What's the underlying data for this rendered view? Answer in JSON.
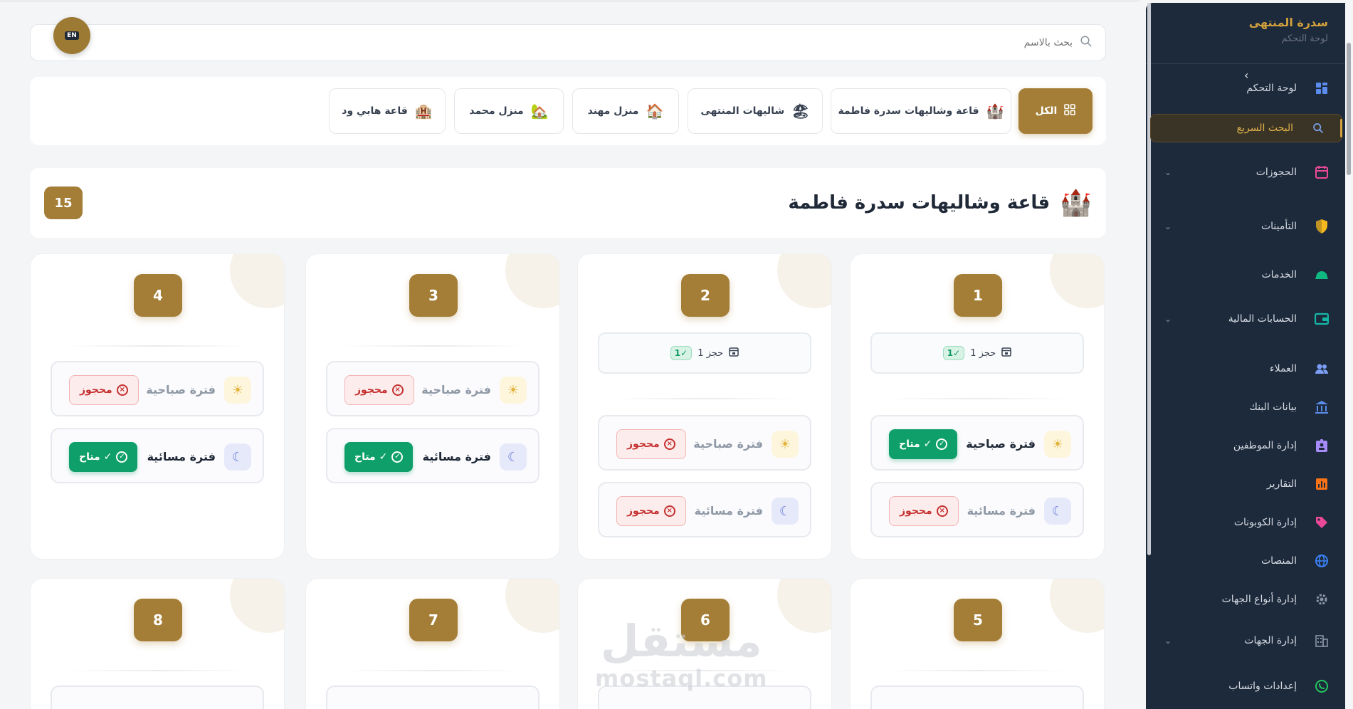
{
  "sidebar": {
    "brand_title": "سدرة المنتهى",
    "brand_subtitle": "لوحة التحكم",
    "items": [
      {
        "label": "لوحة التحكم",
        "icon": "dashboard-icon"
      },
      {
        "label": "البحث السريع",
        "icon": "search-icon",
        "active": true
      },
      {
        "label": "الحجوزات",
        "icon": "calendar-icon",
        "expandable": true
      },
      {
        "label": "التأمينات",
        "icon": "shield-icon",
        "expandable": true
      },
      {
        "label": "الخدمات",
        "icon": "cloche-icon"
      },
      {
        "label": "الحسابات المالية",
        "icon": "wallet-icon",
        "expandable": true
      },
      {
        "label": "العملاء",
        "icon": "users-icon"
      },
      {
        "label": "بيانات البنك",
        "icon": "bank-icon"
      },
      {
        "label": "إدارة الموظفين",
        "icon": "id-badge-icon"
      },
      {
        "label": "التقارير",
        "icon": "chart-icon"
      },
      {
        "label": "إدارة الكوبونات",
        "icon": "tag-icon"
      },
      {
        "label": "المنصات",
        "icon": "globe-icon"
      },
      {
        "label": "إدارة أنواع الجهات",
        "icon": "gear-icon"
      },
      {
        "label": "إدارة الجهات",
        "icon": "building-icon",
        "expandable": true
      },
      {
        "label": "إعدادات واتساب",
        "icon": "whatsapp-icon"
      }
    ]
  },
  "search": {
    "placeholder": "بحث بالاسم"
  },
  "lang_button": "EN",
  "filters": [
    {
      "label": "الكل",
      "active": true
    },
    {
      "label": "قاعة وشاليهات سدرة فاطمة",
      "icon": "castle-icon"
    },
    {
      "label": "شاليهات المنتهى",
      "icon": "beach-icon"
    },
    {
      "label": "منزل مهند",
      "icon": "house-icon"
    },
    {
      "label": "منزل محمد",
      "icon": "house-garden-icon"
    },
    {
      "label": "قاعة هابي ود",
      "icon": "hall-icon"
    }
  ],
  "venue": {
    "title": "قاعة وشاليهات سدرة فاطمة",
    "count": "15"
  },
  "units": [
    {
      "number": "1",
      "booking": {
        "text": "1 حجز",
        "badge": "1✓"
      },
      "morning": {
        "label": "فترة صباحية",
        "status": "متاح ✓",
        "free": true
      },
      "evening": {
        "label": "فترة مسائية",
        "status": "محجوز",
        "free": false
      }
    },
    {
      "number": "2",
      "booking": {
        "text": "1 حجز",
        "badge": "1✓"
      },
      "morning": {
        "label": "فترة صباحية",
        "status": "محجوز",
        "free": false
      },
      "evening": {
        "label": "فترة مسائية",
        "status": "محجوز",
        "free": false
      }
    },
    {
      "number": "3",
      "morning": {
        "label": "فترة صباحية",
        "status": "محجوز",
        "free": false
      },
      "evening": {
        "label": "فترة مسائية",
        "status": "متاح ✓",
        "free": true
      }
    },
    {
      "number": "4",
      "morning": {
        "label": "فترة صباحية",
        "status": "محجوز",
        "free": false
      },
      "evening": {
        "label": "فترة مسائية",
        "status": "متاح ✓",
        "free": true
      }
    },
    {
      "number": "5"
    },
    {
      "number": "6"
    },
    {
      "number": "7"
    },
    {
      "number": "8"
    }
  ],
  "watermark": {
    "arabic": "مستقل",
    "latin": "mostaql.com"
  },
  "colors": {
    "gold": "#a47e36",
    "sidebar": "#1d2a3c",
    "green": "#0f9f6a",
    "red": "#c53030"
  }
}
